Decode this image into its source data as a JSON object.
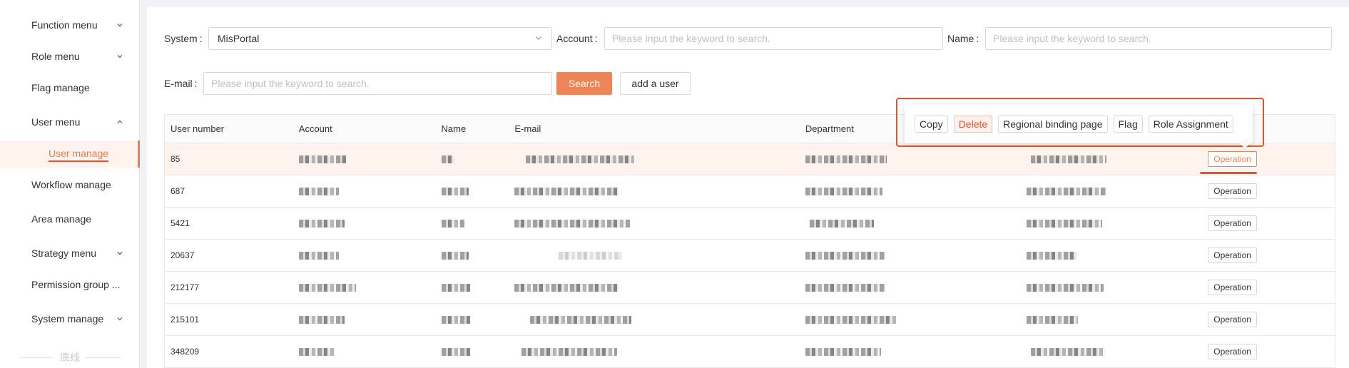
{
  "sidebar": {
    "items": [
      {
        "label": "Function menu",
        "chevron": "chevron-down-icon"
      },
      {
        "label": "Role menu",
        "chevron": "chevron-down-icon"
      },
      {
        "label": "Flag manage"
      },
      {
        "label": "User menu",
        "chevron": "chevron-up-icon"
      },
      {
        "label": "User manage",
        "active": true
      },
      {
        "label": "Workflow manage"
      },
      {
        "label": "Area manage"
      },
      {
        "label": "Strategy menu",
        "chevron": "chevron-down-icon"
      },
      {
        "label": "Permission group ..."
      },
      {
        "label": "System manage",
        "chevron": "chevron-down-icon"
      }
    ],
    "footer": "底线"
  },
  "filters": {
    "system_label": "System",
    "system_value": "MisPortal",
    "account_label": "Account",
    "account_placeholder": "Please input the keyword to search.",
    "name_label": "Name",
    "name_placeholder": "Please input the keyword to search.",
    "email_label": "E-mail",
    "email_placeholder": "Please input the keyword to search.",
    "search_label": "Search",
    "add_user_label": "add a user"
  },
  "table": {
    "headers": [
      "User number",
      "Account",
      "Name",
      "E-mail",
      "Department",
      "",
      ""
    ],
    "rows": [
      {
        "user_number": "85",
        "operation": "Operation"
      },
      {
        "user_number": "687",
        "operation": "Operation"
      },
      {
        "user_number": "5421",
        "operation": "Operation"
      },
      {
        "user_number": "20637",
        "operation": "Operation"
      },
      {
        "user_number": "212177",
        "operation": "Operation"
      },
      {
        "user_number": "215101",
        "operation": "Operation"
      },
      {
        "user_number": "348209",
        "operation": "Operation"
      }
    ]
  },
  "popover": {
    "copy": "Copy",
    "delete": "Delete",
    "regional": "Regional binding page",
    "flag": "Flag",
    "role_assignment": "Role Assignment"
  },
  "colors": {
    "accent": "#ef8457",
    "highlight_outline": "#e4522c",
    "active_row_bg": "#fff4ed"
  }
}
